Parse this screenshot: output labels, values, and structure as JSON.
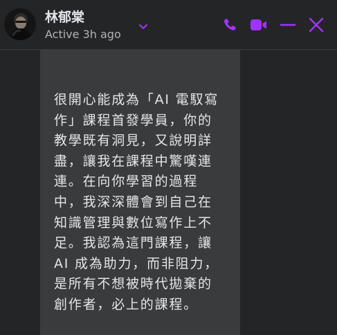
{
  "header": {
    "contact_name": "林郁棠",
    "status": "Active 3h ago"
  },
  "icons": {
    "avatar": "profile-photo",
    "chevron": "chevron-down-icon",
    "phone": "phone-icon",
    "video": "video-camera-icon",
    "minimize": "minimize-icon",
    "close": "close-icon"
  },
  "colors": {
    "accent": "#a033ff",
    "background": "#242526",
    "bubble": "#3a3b3c"
  },
  "message": {
    "lines": [
      "很開心能成為「AI 電馭寫",
      "作」課程首發學員，你的",
      "教學既有洞見，又說明詳",
      "盡，讓我在課程中驚嘆連",
      "連。在向你學習的過程",
      "中，我深深體會到自己在",
      "知識管理與數位寫作上不",
      "足。我認為這門課程，讓",
      "AI 成為助力，而非阻力，",
      "是所有不想被時代拋棄的",
      "創作者，必上的課程。"
    ]
  }
}
